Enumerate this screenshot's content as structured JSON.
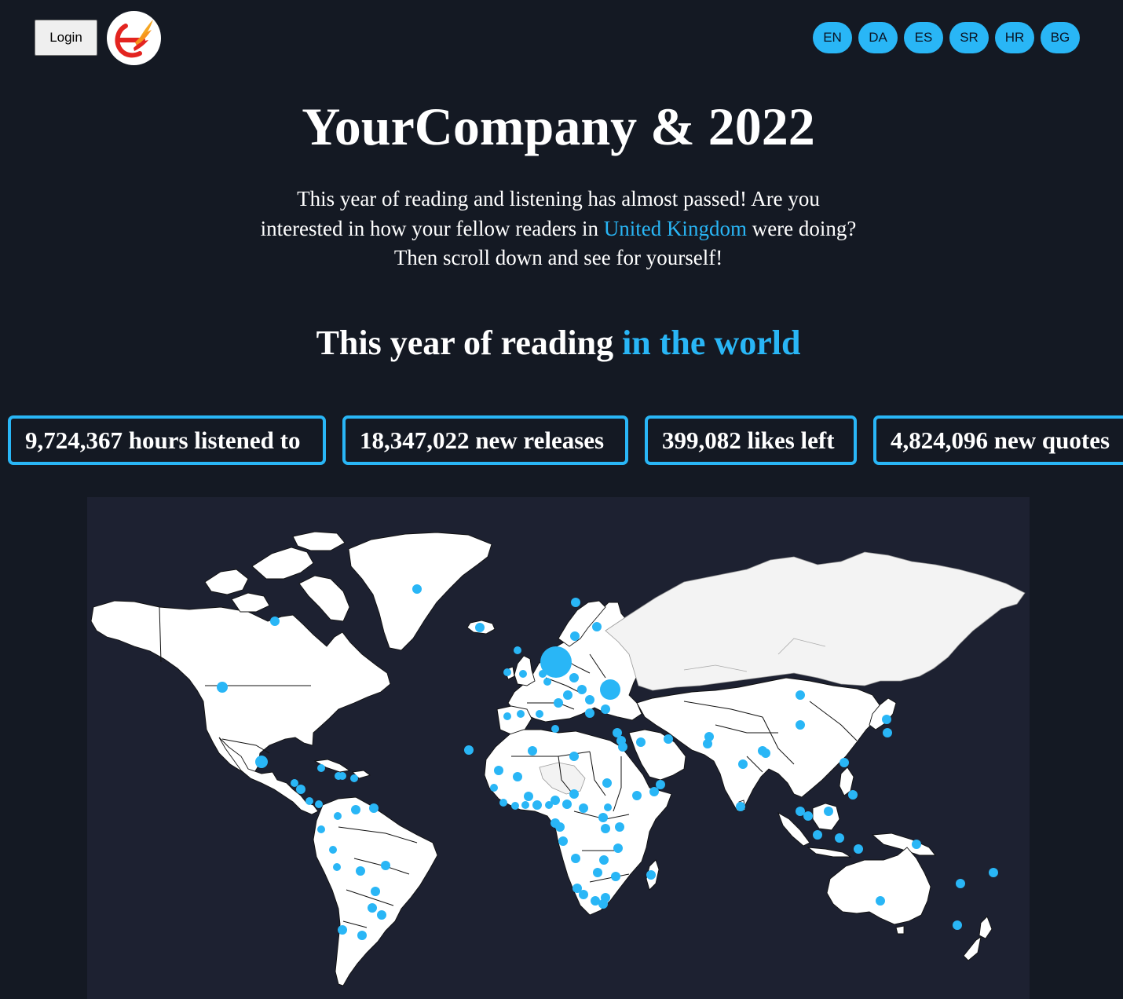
{
  "header": {
    "login_label": "Login",
    "logo_icon": "bird-logo-icon",
    "languages": [
      "EN",
      "DA",
      "ES",
      "SR",
      "HR",
      "BG"
    ]
  },
  "title": "YourCompany & 2022",
  "intro": {
    "before": "This year of reading and listening has almost passed! Are you interested in how your fellow readers in ",
    "country": "United Kingdom",
    "after": " were doing? Then scroll down and see for yourself!"
  },
  "world_heading": {
    "main": "This year of reading ",
    "highlight": "in the world"
  },
  "stats": [
    "9,724,367 hours listened to",
    "18,347,022 new releases",
    "399,082 likes left",
    "4,824,096 new quotes"
  ],
  "colors": {
    "background": "#141923",
    "map_panel": "#1d2131",
    "accent": "#29b6f6",
    "land": "#ffffff",
    "russia": "#f3f3f3"
  }
}
